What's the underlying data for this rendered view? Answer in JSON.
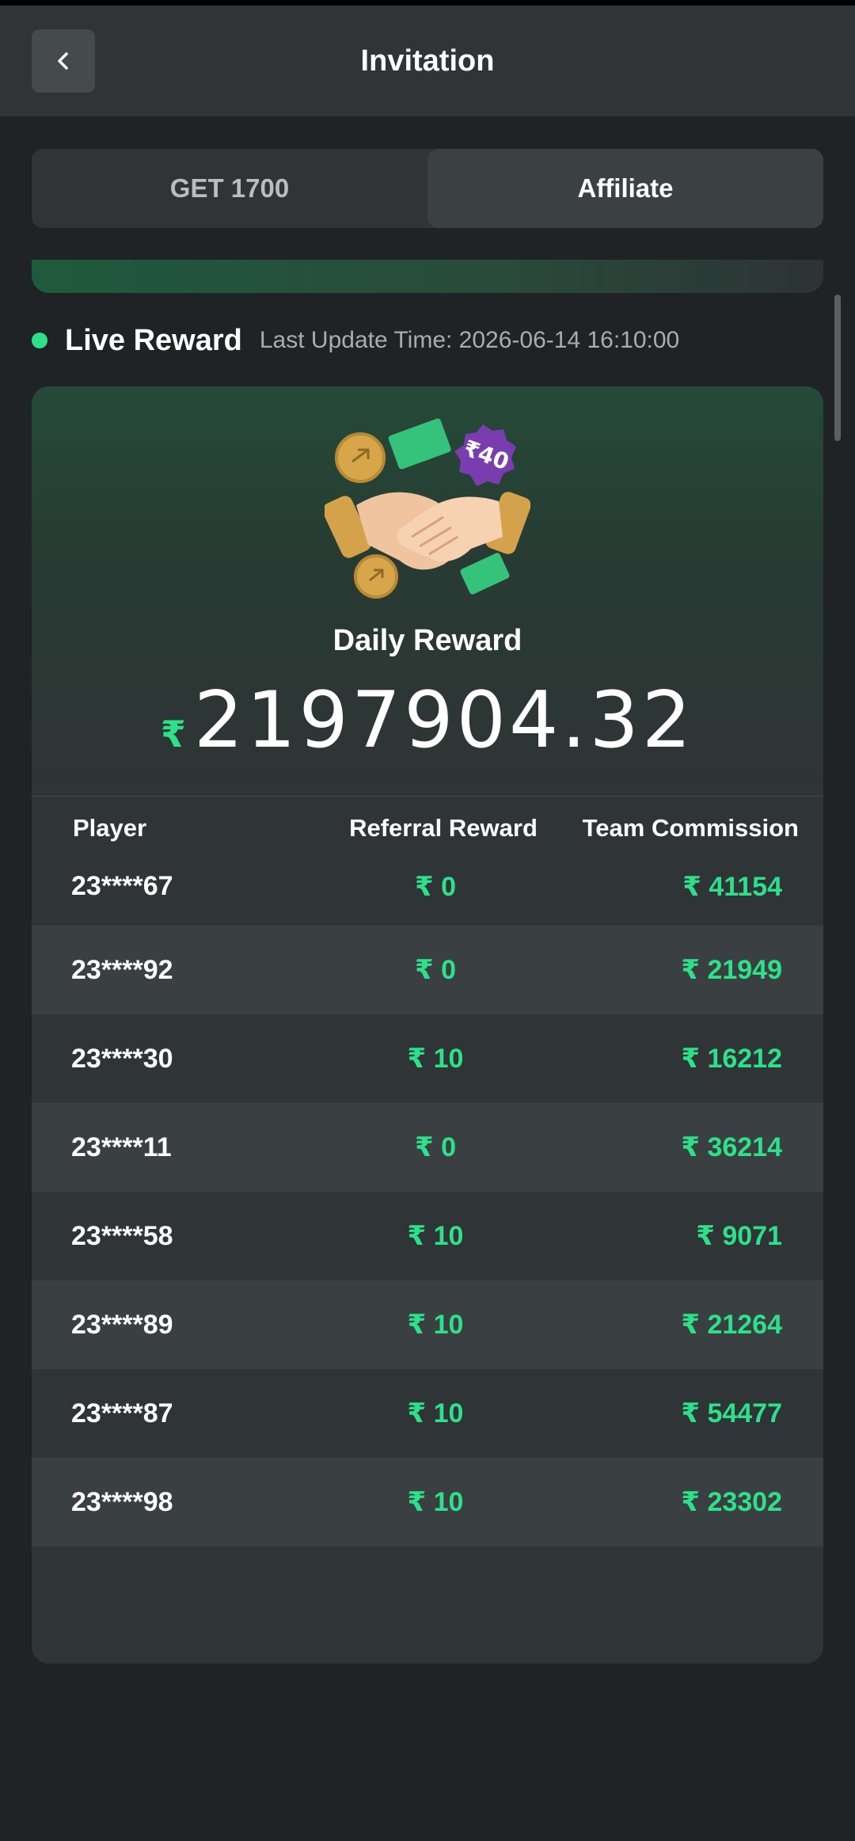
{
  "header": {
    "title": "Invitation",
    "back_icon": "chevron-left-icon"
  },
  "tabs": [
    {
      "label": "GET 1700",
      "active": false
    },
    {
      "label": "Affiliate",
      "active": true
    }
  ],
  "live": {
    "label": "Live Reward",
    "update_text": "Last Update Time: 2026-06-14 16:10:00",
    "dot_color": "#2fe08a"
  },
  "reward": {
    "badge_text": "₹40",
    "title": "Daily Reward",
    "currency": "₹",
    "amount": "2197904.32"
  },
  "table": {
    "headers": [
      "Player",
      "Referral Reward",
      "Team Commission"
    ],
    "rows": [
      {
        "player": "23****67",
        "referral": "₹ 0",
        "commission": "₹ 41154"
      },
      {
        "player": "23****92",
        "referral": "₹ 0",
        "commission": "₹ 21949"
      },
      {
        "player": "23****30",
        "referral": "₹ 10",
        "commission": "₹ 16212"
      },
      {
        "player": "23****11",
        "referral": "₹ 0",
        "commission": "₹ 36214"
      },
      {
        "player": "23****58",
        "referral": "₹ 10",
        "commission": "₹ 9071"
      },
      {
        "player": "23****89",
        "referral": "₹ 10",
        "commission": "₹ 21264"
      },
      {
        "player": "23****87",
        "referral": "₹ 10",
        "commission": "₹ 54477"
      },
      {
        "player": "23****98",
        "referral": "₹ 10",
        "commission": "₹ 23302"
      }
    ]
  },
  "colors": {
    "accent": "#2fe08a",
    "background": "#202325",
    "card": "#2f3436"
  }
}
